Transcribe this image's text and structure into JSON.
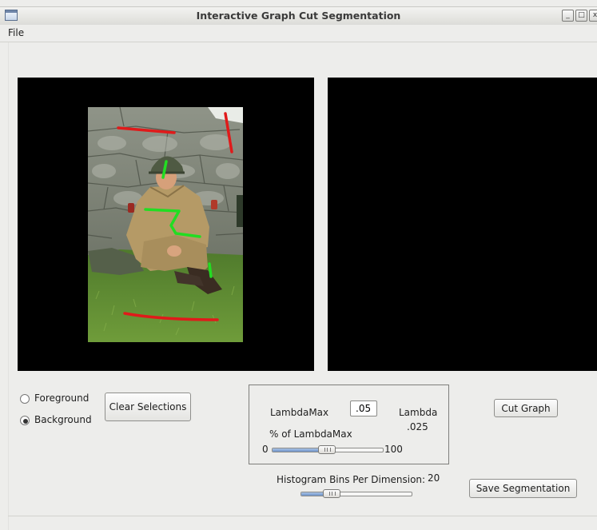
{
  "window": {
    "title": "Interactive Graph Cut Segmentation"
  },
  "menu": {
    "file": "File"
  },
  "controls": {
    "foreground_label": "Foreground",
    "background_label": "Background",
    "selected": "Background",
    "clear_selections": "Clear Selections",
    "cut_graph": "Cut Graph",
    "save_segmentation": "Save Segmentation"
  },
  "lambda": {
    "lambda_max_label": "LambdaMax",
    "lambda_max_value": ".05",
    "lambda_label": "Lambda",
    "lambda_value": ".025",
    "percent_label": "% of LambdaMax",
    "slider_min": "0",
    "slider_max": "100",
    "slider_percent": 50
  },
  "histogram": {
    "label": "Histogram Bins Per Dimension:",
    "value": "20",
    "slider_fraction": 0.24
  },
  "colors": {
    "foreground_stroke": "#22dd22",
    "background_stroke": "#e01a1a",
    "canvas": "#000000"
  }
}
